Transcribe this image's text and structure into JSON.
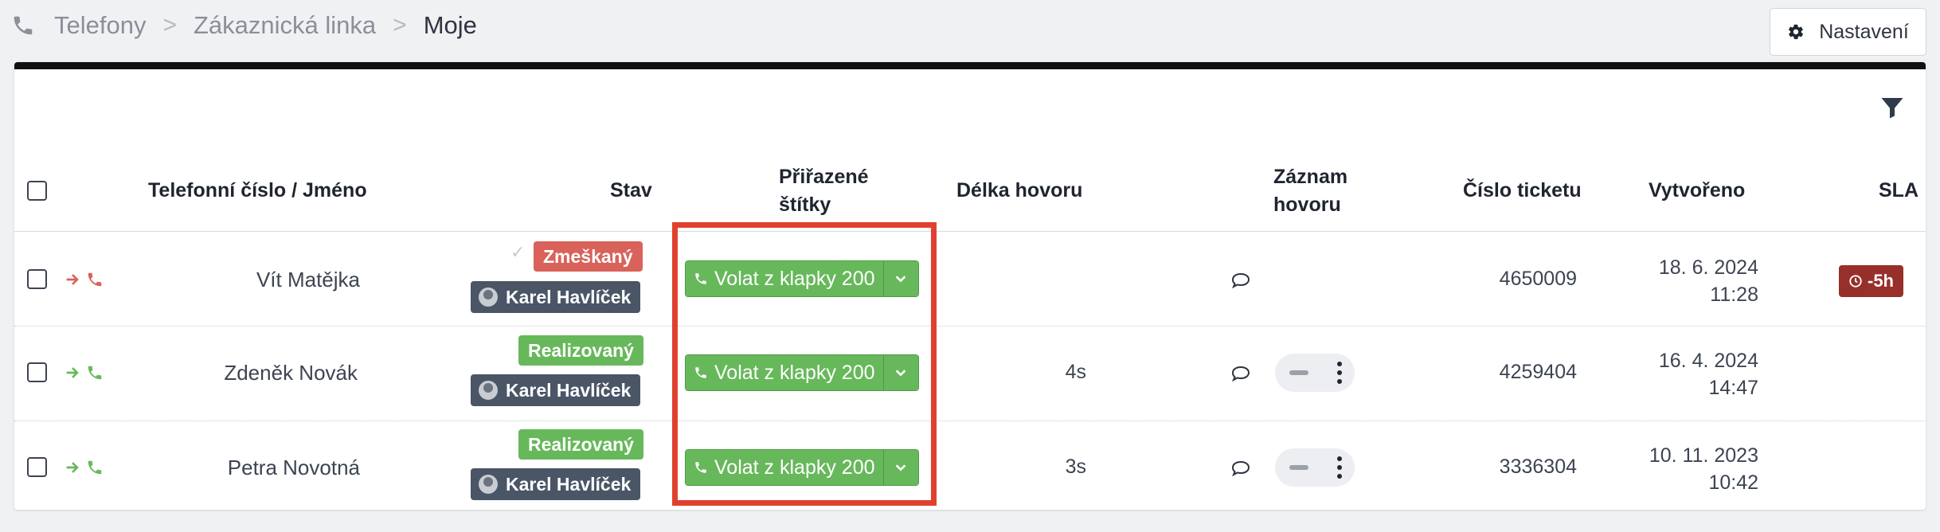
{
  "breadcrumb": {
    "icon": "phone-icon",
    "items": [
      "Telefony",
      "Zákaznická linka",
      "Moje"
    ],
    "separator": ">"
  },
  "settings_button": {
    "label": "Nastavení",
    "icon": "gear-icon"
  },
  "table": {
    "headers": {
      "phone_name": "Telefonní číslo / Jméno",
      "status": "Stav",
      "tags_line1": "Přiřazené",
      "tags_line2": "štítky",
      "duration": "Délka hovoru",
      "recording_line1": "Záznam",
      "recording_line2": "hovoru",
      "ticket": "Číslo ticketu",
      "created": "Vytvořeno",
      "sla": "SLA"
    },
    "rows": [
      {
        "direction": "outgoing",
        "direction_color": "#d9625a",
        "name": "Vít Matějka",
        "status": "Zmeškaný",
        "status_color": "#d9625a",
        "agent": "Karel Havlíček",
        "tag": "Volat z klapky 200",
        "duration": "",
        "ticket": "4650009",
        "created_date": "18. 6. 2024",
        "created_time": "11:28",
        "sla": "-5h",
        "has_recording": false
      },
      {
        "direction": "outgoing",
        "direction_color": "#67b85b",
        "name": "Zdeněk Novák",
        "status": "Realizovaný",
        "status_color": "#67b85b",
        "agent": "Karel Havlíček",
        "tag": "Volat z klapky 200",
        "duration": "4s",
        "ticket": "4259404",
        "created_date": "16. 4. 2024",
        "created_time": "14:47",
        "sla": "",
        "has_recording": true
      },
      {
        "direction": "outgoing",
        "direction_color": "#67b85b",
        "name": "Petra Novotná",
        "status": "Realizovaný",
        "status_color": "#67b85b",
        "agent": "Karel Havlíček",
        "tag": "Volat z klapky 200",
        "duration": "3s",
        "ticket": "3336304",
        "created_date": "10. 11. 2023",
        "created_time": "10:42",
        "sla": "",
        "has_recording": true
      }
    ]
  }
}
